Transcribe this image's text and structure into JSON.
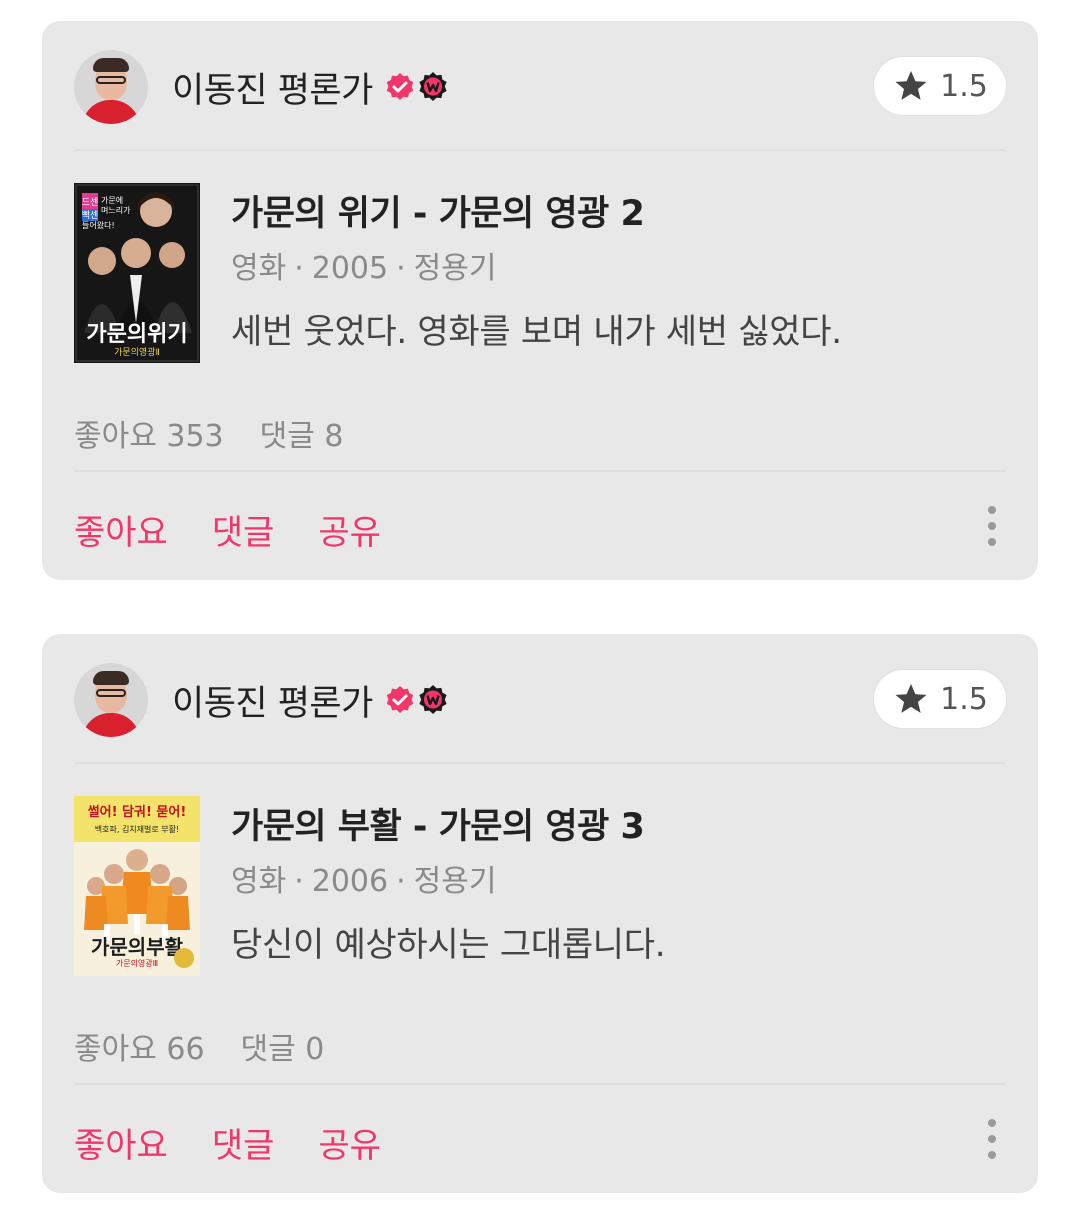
{
  "colors": {
    "accent": "#f2366a",
    "card_bg": "#e8e8e8",
    "muted_text": "#8a8a8a"
  },
  "reviews": [
    {
      "author": "이동진 평론가",
      "badges": [
        "verified-check-icon",
        "watcha-w-icon"
      ],
      "rating": "1.5",
      "movie_title": "가문의 위기 - 가문의 영광 2",
      "category": "영화",
      "year": "2005",
      "director": "정용기",
      "meta_separator": "·",
      "comment": "세번 웃었다. 영화를 보며 내가 세번 싫었다.",
      "likes_label": "좋아요",
      "likes_count": "353",
      "comments_label": "댓글",
      "comments_count": "8",
      "poster_text": {
        "tagline_1": "드센",
        "tagline_2": "빡센",
        "tagline_3": "가문에",
        "tagline_4": "며느리가",
        "tagline_5": "들어왔다!",
        "logo": "가문의위기",
        "logo_sub": "가문의영광Ⅱ"
      },
      "actions": {
        "like": "좋아요",
        "comment": "댓글",
        "share": "공유"
      }
    },
    {
      "author": "이동진 평론가",
      "badges": [
        "verified-check-icon",
        "watcha-w-icon"
      ],
      "rating": "1.5",
      "movie_title": "가문의 부활 - 가문의 영광 3",
      "category": "영화",
      "year": "2006",
      "director": "정용기",
      "meta_separator": "·",
      "comment": "당신이 예상하시는 그대롭니다.",
      "likes_label": "좋아요",
      "likes_count": "66",
      "comments_label": "댓글",
      "comments_count": "0",
      "poster_text": {
        "tagline_1": "썰어! 담궈! 묻어!",
        "tagline_2": "백호파, 김치재벌로 부활!",
        "logo": "가문의부활",
        "logo_sub": "가문의영광Ⅲ"
      },
      "actions": {
        "like": "좋아요",
        "comment": "댓글",
        "share": "공유"
      }
    }
  ]
}
